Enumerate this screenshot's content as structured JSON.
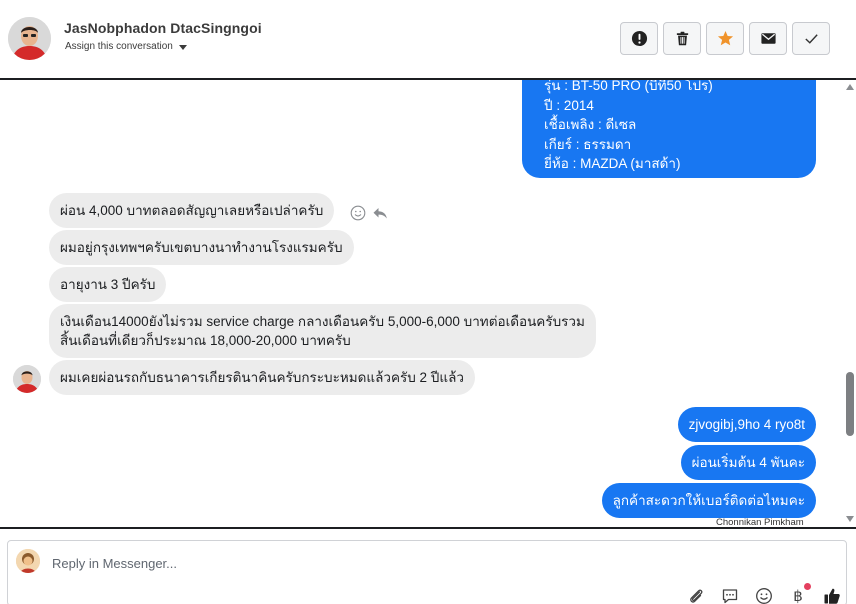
{
  "contact": {
    "name": "JasNobphadon DtacSingngoi",
    "assign_label": "Assign this conversation"
  },
  "header_actions": [
    {
      "icon": "alert-icon"
    },
    {
      "icon": "trash-icon"
    },
    {
      "icon": "star-icon"
    },
    {
      "icon": "envelope-icon"
    },
    {
      "icon": "check-icon"
    }
  ],
  "colors": {
    "outgoing_bubble": "#1877f2",
    "incoming_bubble": "#ececec",
    "star": "#f0932b"
  },
  "thread": {
    "outgoing_block_lines": [
      "รุ่น : BT-50 PRO (บีที50 โปร)",
      "ปี : 2014",
      "เชื้อเพลิง : ดีเซล",
      "เกียร์ : ธรรมดา",
      "ยี่ห้อ : MAZDA (มาสด้า)"
    ],
    "incoming": [
      "ผ่อน 4,000 บาทตลอดสัญญาเลยหรือเปล่าครับ",
      "ผมอยู่กรุงเทพฯครับเขตบางนาทำงานโรงแรมครับ",
      "อายุงาน 3 ปีครับ",
      "เงินเดือน14000ยังไม่รวม service charge กลางเดือนครับ 5,000-6,000 บาทต่อเดือนครับรวม",
      "สิ้นเดือนที่เดียวก็ประมาณ 18,000-20,000 บาทครับ",
      "ผมเคยผ่อนรถกับธนาคารเกียรตินาคินครับกระบะหมดแล้วครับ 2 ปีแล้ว"
    ],
    "outgoing": [
      "zjvogibj,9ho 4 ryo8t",
      "ผ่อนเริ่มต้น 4 พันคะ",
      "ลูกค้าสะดวกให้เบอร์ติดต่อไหมคะ"
    ],
    "sender_label": "Chonnikan Pimkham"
  },
  "composer": {
    "placeholder": "Reply in Messenger...",
    "tools": [
      "attachment-icon",
      "saved-reply-icon",
      "emoji-icon",
      "baht-payment-icon",
      "like-icon"
    ],
    "baht_symbol": "฿"
  }
}
